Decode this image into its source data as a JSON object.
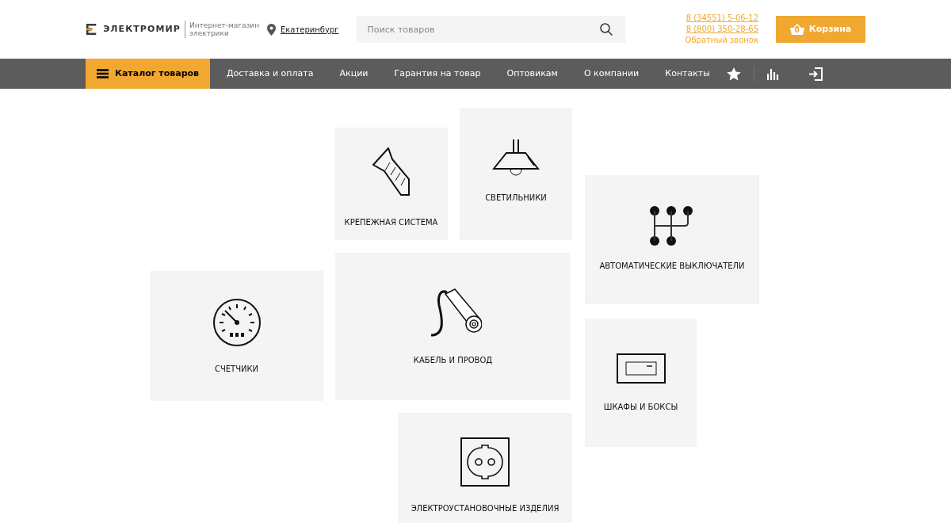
{
  "header": {
    "logo_text": "ЭЛЕКТРОМИР",
    "tagline": "Интернет-магазин электрики",
    "city": "Екатеринбург",
    "search": {
      "placeholder": "Поиск товаров"
    },
    "phones": [
      "8 (34551) 5-06-12",
      "8 (800) 350-28-65"
    ],
    "callback": "Обратный звонок",
    "cart": {
      "count": "0",
      "label": "Корзина"
    }
  },
  "nav": {
    "catalog": "Каталог товаров",
    "items": [
      "Доставка и оплата",
      "Акции",
      "Гарантия на товар",
      "Оптовикам",
      "О компании",
      "Контакты"
    ]
  },
  "categories": [
    {
      "kind": "screw",
      "label": "КРЕПЕЖНАЯ СИСТЕМА"
    },
    {
      "kind": "lamp",
      "label": "СВЕТИЛЬНИКИ"
    },
    {
      "kind": "breaker",
      "label": "АВТОМАТИЧЕСКИЕ ВЫКЛЮЧАТЕЛИ"
    },
    {
      "kind": "meter",
      "label": "СЧЕТЧИКИ"
    },
    {
      "kind": "cable",
      "label": "КАБЕЛЬ И ПРОВОД"
    },
    {
      "kind": "box",
      "label": "ШКАФЫ И БОКСЫ"
    },
    {
      "kind": "socket",
      "label": "ЭЛЕКТРОУСТАНОВОЧНЫЕ ИЗДЕЛИЯ"
    }
  ]
}
